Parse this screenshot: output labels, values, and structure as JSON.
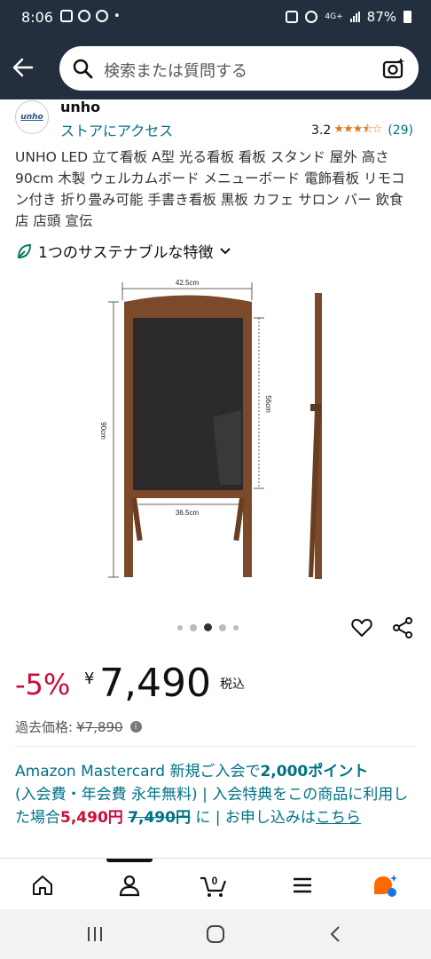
{
  "status_bar": {
    "time": "8:06",
    "dot": "•",
    "network": "4G+",
    "battery": "87%"
  },
  "search": {
    "placeholder": "検索または質問する"
  },
  "brand": {
    "logo_text": "unho",
    "name": "unho",
    "store_link": "ストアにアクセス"
  },
  "rating": {
    "value": "3.2",
    "stars": 3.5,
    "count": "(29)"
  },
  "product": {
    "title": "UNHO LED 立て看板 A型 光る看板 看板 スタンド 屋外 高さ90cm 木製 ウェルカムボード メニューボード 電飾看板 リモコン付き 折り畳み可能 手書き看板 黒板 カフェ サロン バー 飲食店 店頭 宣伝",
    "sustainability": "1つのサステナブルな特徴",
    "image_dims": {
      "width_top": "42.5cm",
      "height_total": "90cm",
      "board_height": "56cm",
      "width_bottom": "36.5cm"
    },
    "carousel": {
      "count": 5,
      "active_index": 2
    }
  },
  "price": {
    "discount": "-5%",
    "currency": "¥",
    "value": "7,490",
    "tax": "税込",
    "list_label": "過去価格:",
    "list_value": "¥7,890"
  },
  "promo": {
    "line1_a": "Amazon Mastercard 新規ご入会で",
    "line1_b": "2,000ポイント",
    "line2": "(入会費・年会費 永年無料) | 入会特典をこの商品に利用した場合",
    "price_after": "5,490円",
    "price_before": "7,490円",
    "tail": "に | お申し込みは",
    "link": "こちら"
  },
  "bottom_nav": {
    "cart_count": "0"
  },
  "colors": {
    "header": "#232f3e",
    "link": "#007185",
    "deal": "#cc0c39",
    "star": "#de7921"
  }
}
